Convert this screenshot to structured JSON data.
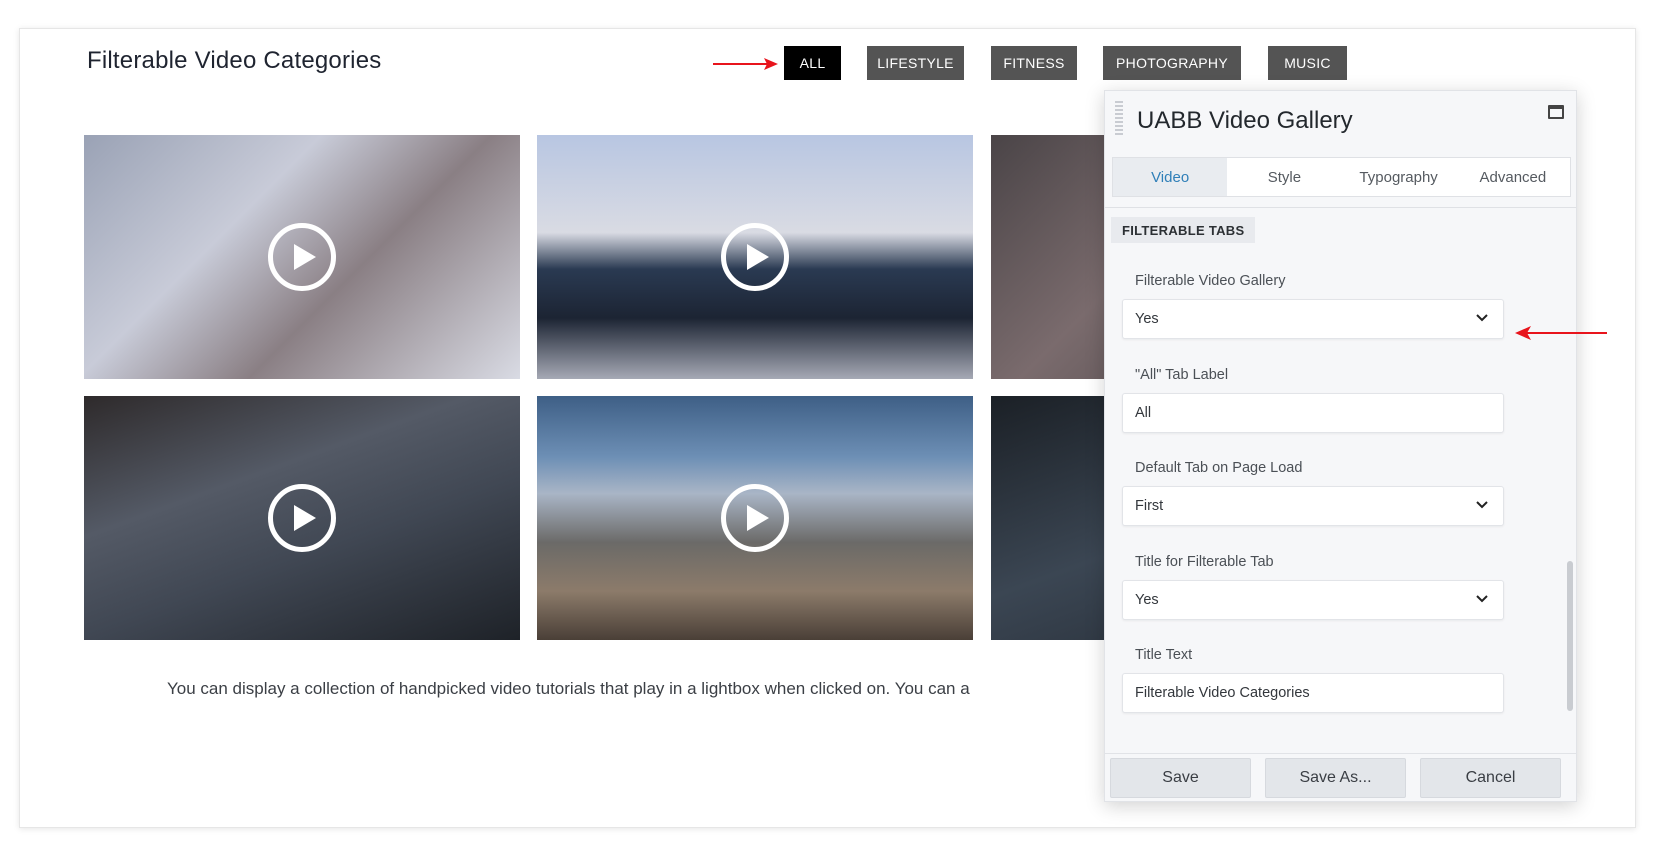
{
  "page": {
    "title": "Filterable Video Categories",
    "description": "You can display a collection of handpicked video tutorials that play in a lightbox when clicked on. You can a"
  },
  "filters": {
    "items": [
      {
        "label": "ALL",
        "active": true
      },
      {
        "label": "LIFESTYLE",
        "active": false
      },
      {
        "label": "FITNESS",
        "active": false
      },
      {
        "label": "PHOTOGRAPHY",
        "active": false
      },
      {
        "label": "MUSIC",
        "active": false
      }
    ],
    "active_color": "#000000",
    "inactive_color": "#545454"
  },
  "gallery": {
    "icon": "play-icon",
    "videos": [
      "lifestyle-video-1",
      "photography-video-1",
      "fitness-video-1",
      "fitness-video-2",
      "photography-video-2",
      "fitness-video-3"
    ]
  },
  "panel": {
    "title": "UABB Video Gallery",
    "tabs": [
      {
        "label": "Video",
        "active": true
      },
      {
        "label": "Style",
        "active": false
      },
      {
        "label": "Typography",
        "active": false
      },
      {
        "label": "Advanced",
        "active": false
      }
    ],
    "section": "FILTERABLE TABS",
    "fields": {
      "filterable_gallery": {
        "label": "Filterable Video Gallery",
        "value": "Yes"
      },
      "all_tab_label": {
        "label": "\"All\" Tab Label",
        "value": "All"
      },
      "default_tab": {
        "label": "Default Tab on Page Load",
        "value": "First"
      },
      "title_for_tab": {
        "label": "Title for Filterable Tab",
        "value": "Yes"
      },
      "title_text": {
        "label": "Title Text",
        "value": "Filterable Video Categories"
      }
    },
    "footer": {
      "save": "Save",
      "save_as": "Save As...",
      "cancel": "Cancel"
    },
    "accent_color": "#2f7fb8"
  },
  "annotations": {
    "arrow_color": "#e8141c"
  }
}
